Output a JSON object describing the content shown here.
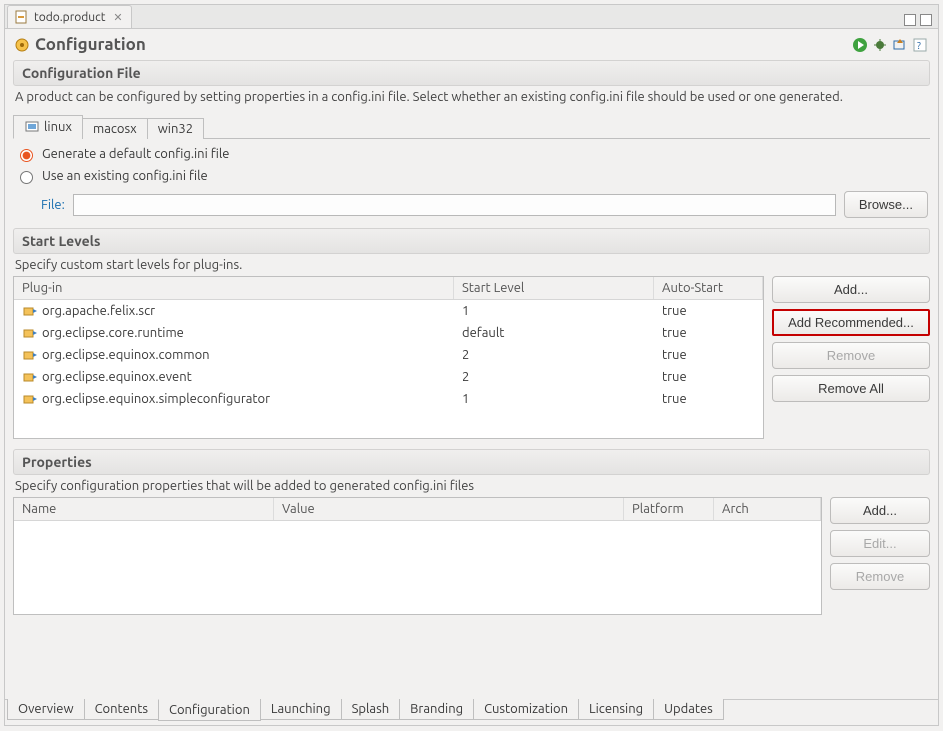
{
  "editor_tab": {
    "title": "todo.product"
  },
  "page": {
    "title": "Configuration"
  },
  "config_file": {
    "section_title": "Configuration File",
    "description": "A product can be configured by setting properties in a config.ini file.  Select whether an existing config.ini file should be used or one generated.",
    "os_tabs": [
      "linux",
      "macosx",
      "win32"
    ],
    "active_os_tab": "linux",
    "radio_generate": "Generate a default config.ini file",
    "radio_existing": "Use an existing config.ini file",
    "radio_selected": "generate",
    "file_label": "File:",
    "file_value": "",
    "browse_label": "Browse..."
  },
  "start_levels": {
    "section_title": "Start Levels",
    "description": "Specify custom start levels for plug-ins.",
    "columns": [
      "Plug-in",
      "Start Level",
      "Auto-Start"
    ],
    "rows": [
      {
        "plugin": "org.apache.felix.scr",
        "start_level": "1",
        "auto_start": "true"
      },
      {
        "plugin": "org.eclipse.core.runtime",
        "start_level": "default",
        "auto_start": "true"
      },
      {
        "plugin": "org.eclipse.equinox.common",
        "start_level": "2",
        "auto_start": "true"
      },
      {
        "plugin": "org.eclipse.equinox.event",
        "start_level": "2",
        "auto_start": "true"
      },
      {
        "plugin": "org.eclipse.equinox.simpleconfigurator",
        "start_level": "1",
        "auto_start": "true"
      }
    ],
    "buttons": {
      "add": "Add...",
      "add_recommended": "Add Recommended...",
      "remove": "Remove",
      "remove_all": "Remove All"
    }
  },
  "properties": {
    "section_title": "Properties",
    "description": "Specify configuration properties that will be added to generated config.ini files",
    "columns": [
      "Name",
      "Value",
      "Platform",
      "Arch"
    ],
    "rows": [],
    "buttons": {
      "add": "Add...",
      "edit": "Edit...",
      "remove": "Remove"
    }
  },
  "bottom_tabs": [
    "Overview",
    "Contents",
    "Configuration",
    "Launching",
    "Splash",
    "Branding",
    "Customization",
    "Licensing",
    "Updates"
  ],
  "active_bottom_tab": "Configuration"
}
